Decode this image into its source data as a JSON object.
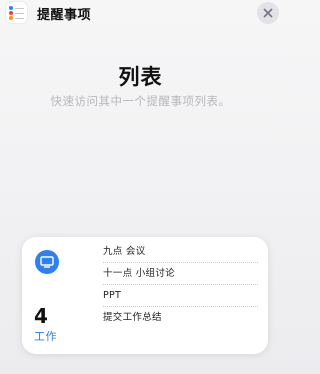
{
  "app": {
    "title": "提醒事项",
    "icon": "reminders-app-icon"
  },
  "close": {
    "icon": "close-icon"
  },
  "header": {
    "title": "列表",
    "subtitle": "快速访问其中一个提醒事项列表。"
  },
  "widget": {
    "list_icon": "monitor-icon",
    "accent_color": "#2f7fee",
    "count": "4",
    "list_name": "工作",
    "items": [
      {
        "label": "九点 会议"
      },
      {
        "label": "十一点 小组讨论"
      },
      {
        "label": "PPT"
      },
      {
        "label": "提交工作总结"
      }
    ]
  }
}
